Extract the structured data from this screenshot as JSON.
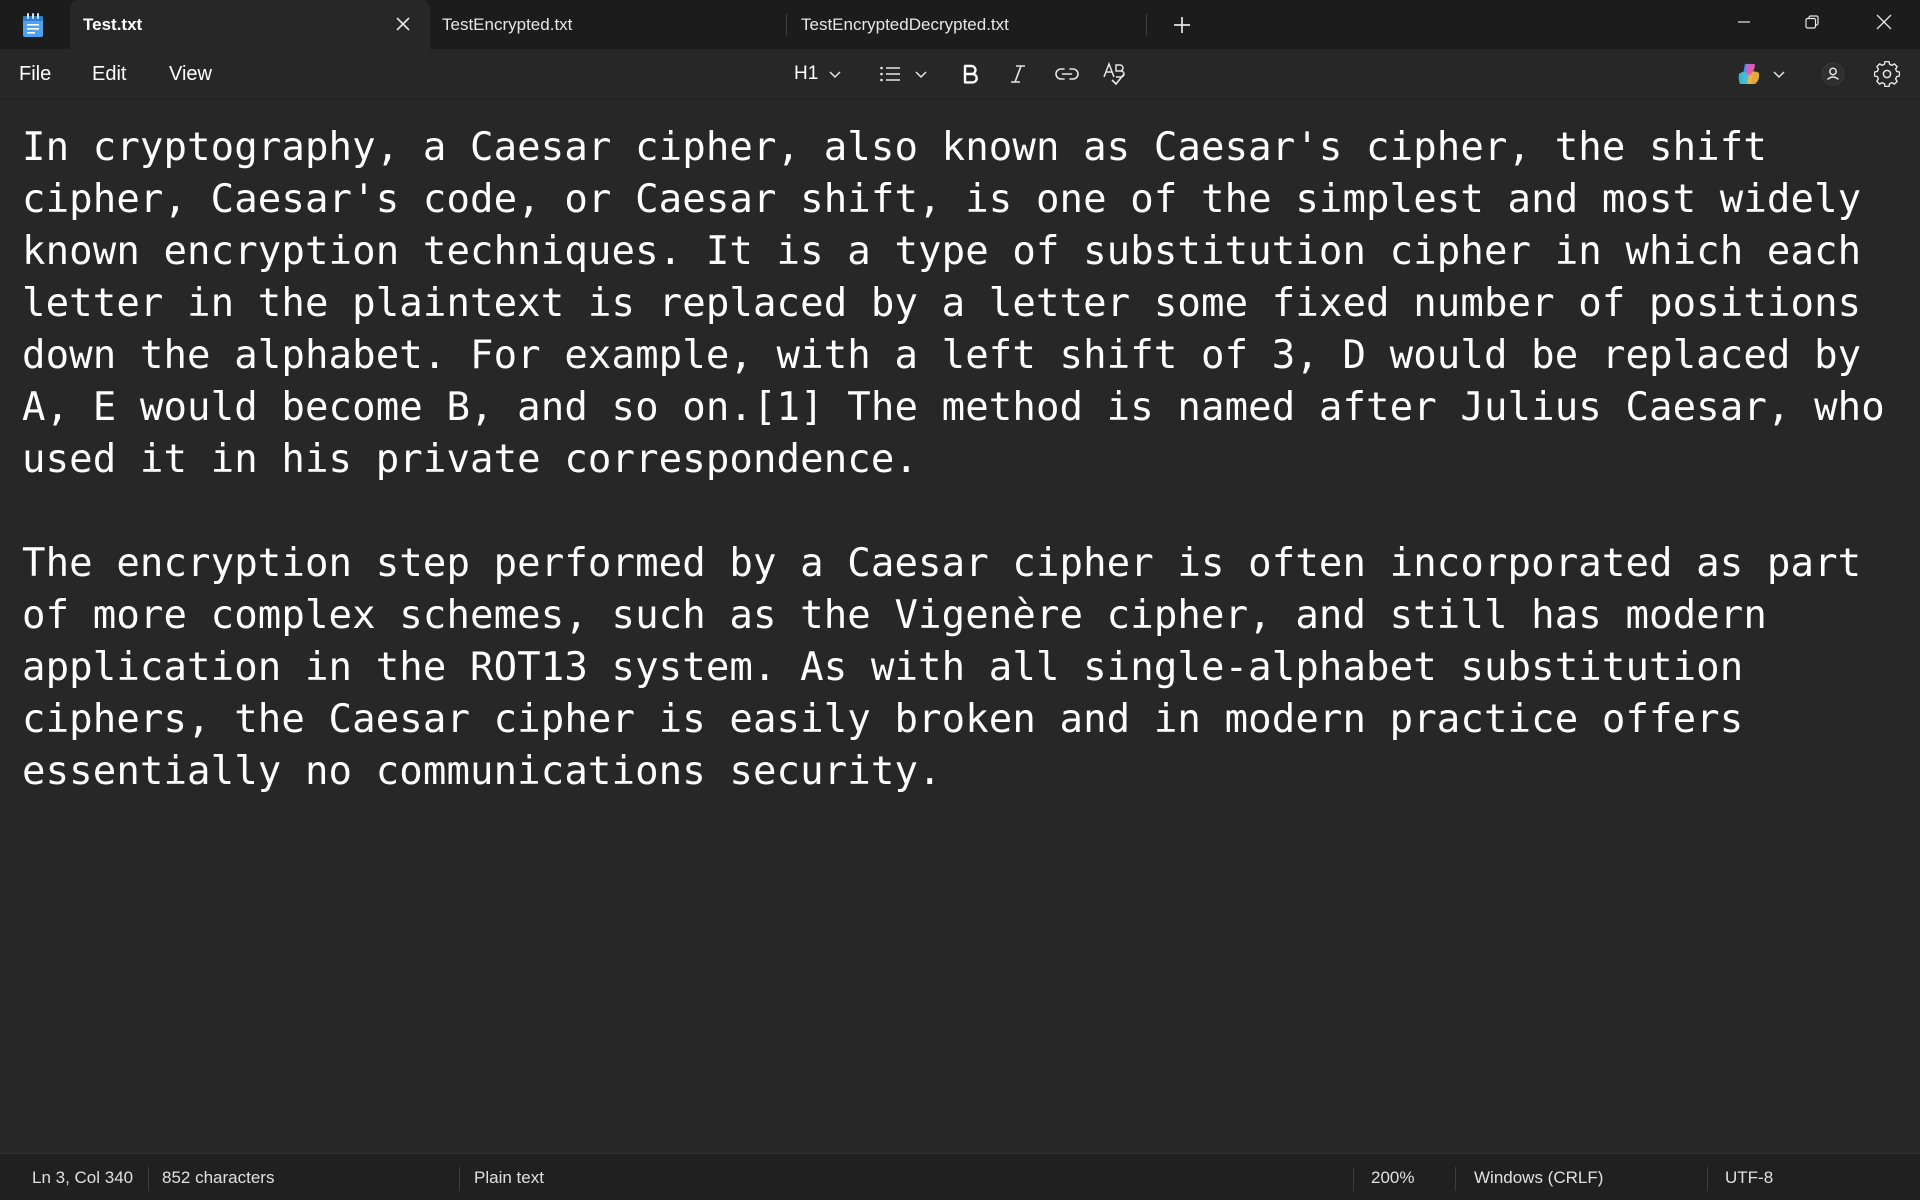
{
  "tabs": [
    {
      "title": "Test.txt",
      "active": true
    },
    {
      "title": "TestEncrypted.txt",
      "active": false
    },
    {
      "title": "TestEncryptedDecrypted.txt",
      "active": false
    }
  ],
  "menu": {
    "file": "File",
    "edit": "Edit",
    "view": "View"
  },
  "toolbar": {
    "heading_label": "H1",
    "icons": [
      "heading-dropdown",
      "list-icon",
      "bold-icon",
      "italic-icon",
      "link-icon",
      "spellcheck-icon",
      "copilot-icon",
      "account-icon",
      "gear-icon"
    ]
  },
  "document": {
    "paragraph1_lines": [
      "In cryptography, a Caesar cipher, also known as Caesar's cipher, the shift",
      "cipher, Caesar's code, or Caesar shift, is one of the simplest and most widely",
      "known encryption techniques. It is a type of substitution cipher in which each",
      "letter in the plaintext is replaced by a letter some fixed number of positions",
      "down the alphabet. For example, with a left shift of 3, D would be replaced by",
      "A, E would become B, and so on.[1] The method is named after Julius Caesar, who",
      "used it in his private correspondence."
    ],
    "paragraph2_lines": [
      "The encryption step performed by a Caesar cipher is often incorporated as part",
      "of more complex schemes, such as the Vigenère cipher, and still has modern",
      "application in the ROT13 system. As with all single-alphabet substitution",
      "ciphers, the Caesar cipher is easily broken and in modern practice offers",
      "essentially no communications security."
    ]
  },
  "status": {
    "position": "Ln 3, Col 340",
    "characters": "852 characters",
    "format": "Plain text",
    "zoom": "200%",
    "line_endings": "Windows (CRLF)",
    "encoding": "UTF-8"
  },
  "colors": {
    "background": "#272727",
    "titlebar": "#1c1c1c",
    "statusbar": "#202020",
    "text": "#ffffff",
    "app_icon": "#4ea3f0"
  }
}
